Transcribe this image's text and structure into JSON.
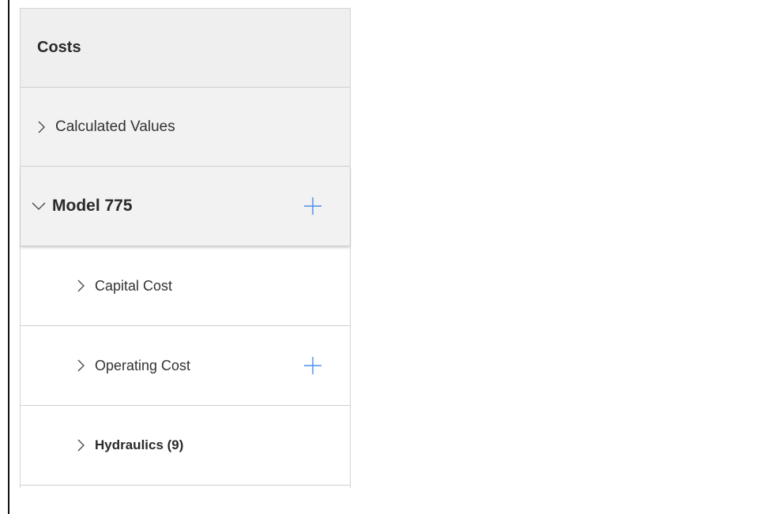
{
  "header": {
    "title": "Costs"
  },
  "tree": {
    "calculated_values": {
      "label": "Calculated Values",
      "expanded": false
    },
    "model": {
      "label": "Model 775",
      "expanded": true
    },
    "children": [
      {
        "label": "Capital Cost",
        "expanded": false,
        "has_add": false,
        "bold": false
      },
      {
        "label": "Operating Cost",
        "expanded": false,
        "has_add": true,
        "bold": false
      },
      {
        "label": "Hydraulics (9)",
        "expanded": false,
        "has_add": false,
        "bold": true
      }
    ]
  },
  "colors": {
    "accent_plus": "#4a8fe8",
    "header_bg": "#efefef",
    "row_bg": "#f2f2f2",
    "child_bg": "#ffffff",
    "divider": "#cfcfcf"
  },
  "icons": {
    "collapsed": "chevron-right-icon",
    "expanded": "chevron-down-icon",
    "add": "plus-icon"
  }
}
